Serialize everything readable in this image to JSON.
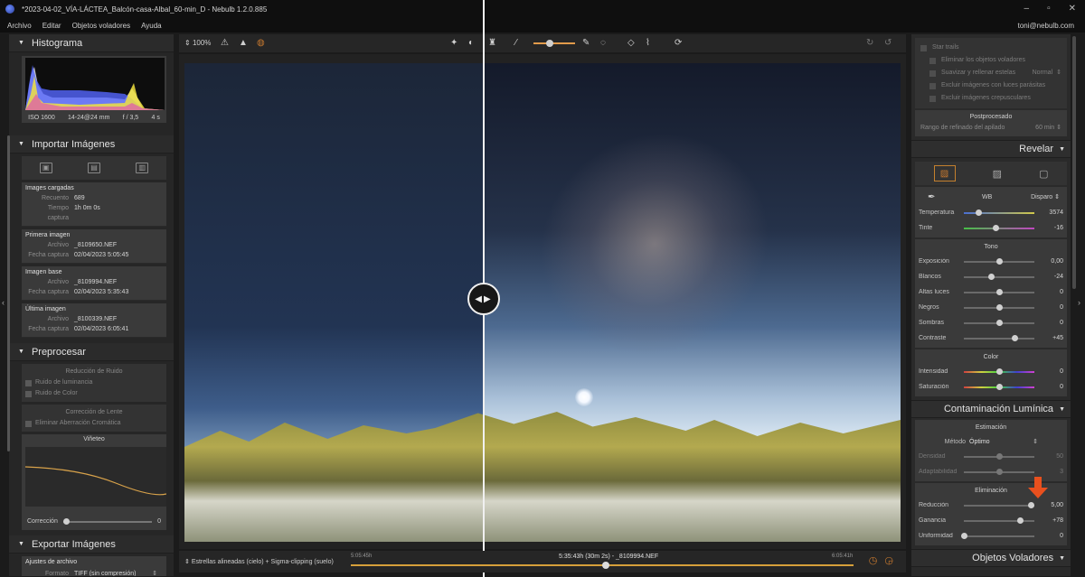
{
  "window": {
    "title": "*2023-04-02_VÍA-LÁCTEA_Balcón-casa-Albal_60-min_D - Nebulb 1.2.0.885",
    "user_email": "toni@nebulb.com"
  },
  "menu": [
    "Archivo",
    "Editar",
    "Objetos voladores",
    "Ayuda"
  ],
  "toolbar": {
    "zoom": "100%"
  },
  "left": {
    "histogram": {
      "title": "Histograma",
      "iso": "ISO 1600",
      "lens": "14-24@24 mm",
      "aperture": "f / 3,5",
      "exposure": "4 s"
    },
    "import": {
      "title": "Importar Imágenes",
      "loaded": {
        "title": "Images cargadas",
        "count_label": "Recuento",
        "count_value": "689",
        "time_label": "Tiempo captura",
        "time_value": "1h 0m 0s"
      },
      "first": {
        "title": "Primera imagen",
        "file_label": "Archivo",
        "file_value": "_8109650.NEF",
        "date_label": "Fecha captura",
        "date_value": "02/04/2023 5:05:45"
      },
      "base": {
        "title": "Imagen base",
        "file_label": "Archivo",
        "file_value": "_8109994.NEF",
        "date_label": "Fecha captura",
        "date_value": "02/04/2023 5:35:43"
      },
      "last": {
        "title": "Última imagen",
        "file_label": "Archivo",
        "file_value": "_8100339.NEF",
        "date_label": "Fecha captura",
        "date_value": "02/04/2023 6:05:41"
      }
    },
    "preprocess": {
      "title": "Preprocesar",
      "noise_title": "Reducción de Ruido",
      "lum_noise": "Ruido de luminancia",
      "color_noise": "Ruido de Color",
      "lens_title": "Corrección de Lente",
      "chromatic": "Eliminar Aberración Cromática",
      "vignette_title": "Viñeteo",
      "correction_label": "Corrección",
      "correction_value": "0"
    },
    "export": {
      "title": "Exportar Imágenes",
      "file_settings": "Ajustes de archivo",
      "format_label": "Formato",
      "format_value": "TIFF (sin compresión)"
    }
  },
  "timeline": {
    "label": "Estrellas alineadas (cielo) + Sigma-clipping (suelo)",
    "start_time": "5:05:45h",
    "center": "5:35:43h (30m 2s) - _8109994.NEF",
    "end_time": "6:05:41h",
    "position": 0.5
  },
  "right": {
    "star_trails": {
      "label": "Star trails",
      "remove_flying": "Eliminar los objetos voladores",
      "smooth": "Suavizar y rellenar estelas",
      "smooth_mode": "Normal",
      "exclude_parasitic": "Excluir imágenes con luces parásitas",
      "exclude_twilight": "Excluir imágenes crepusculares"
    },
    "post": {
      "title": "Postprocesado",
      "range_label": "Rango de refinado del apilado",
      "range_value": "60 min"
    },
    "reveal": {
      "title": "Revelar",
      "wb_label": "WB",
      "wb_mode": "Disparo",
      "temperature": {
        "label": "Temperatura",
        "value": "3574",
        "pos": 0.2
      },
      "tint": {
        "label": "Tinte",
        "value": "-16",
        "pos": 0.45
      },
      "tone_title": "Tono",
      "exposure": {
        "label": "Exposición",
        "value": "0,00",
        "pos": 0.5
      },
      "whites": {
        "label": "Blancos",
        "value": "-24",
        "pos": 0.38
      },
      "highlights": {
        "label": "Altas luces",
        "value": "0",
        "pos": 0.5
      },
      "blacks": {
        "label": "Negros",
        "value": "0",
        "pos": 0.5
      },
      "shadows": {
        "label": "Sombras",
        "value": "0",
        "pos": 0.5
      },
      "contrast": {
        "label": "Contraste",
        "value": "+45",
        "pos": 0.72
      },
      "color_title": "Color",
      "intensity": {
        "label": "Intensidad",
        "value": "0",
        "pos": 0.5
      },
      "saturation": {
        "label": "Saturación",
        "value": "0",
        "pos": 0.5
      }
    },
    "light_pollution": {
      "title": "Contaminación Lumínica",
      "estimation_title": "Estimación",
      "method_label": "Método",
      "method_value": "Óptimo",
      "density": {
        "label": "Densidad",
        "value": "50",
        "pos": 0.5
      },
      "adaptability": {
        "label": "Adaptabilidad",
        "value": "3",
        "pos": 0.5
      },
      "elimination_title": "Eliminación",
      "reduction": {
        "label": "Reducción",
        "value": "5,00",
        "pos": 0.95
      },
      "gain": {
        "label": "Ganancia",
        "value": "+78",
        "pos": 0.8
      },
      "uniformity": {
        "label": "Uniformidad",
        "value": "0",
        "pos": 0.0
      }
    },
    "flying": {
      "title": "Objetos Voladores"
    }
  },
  "colors": {
    "accent": "#c97a2f",
    "background": "#1b1b1b",
    "panel": "#2a2a2a",
    "pointer_arrow": "#e8501e"
  }
}
